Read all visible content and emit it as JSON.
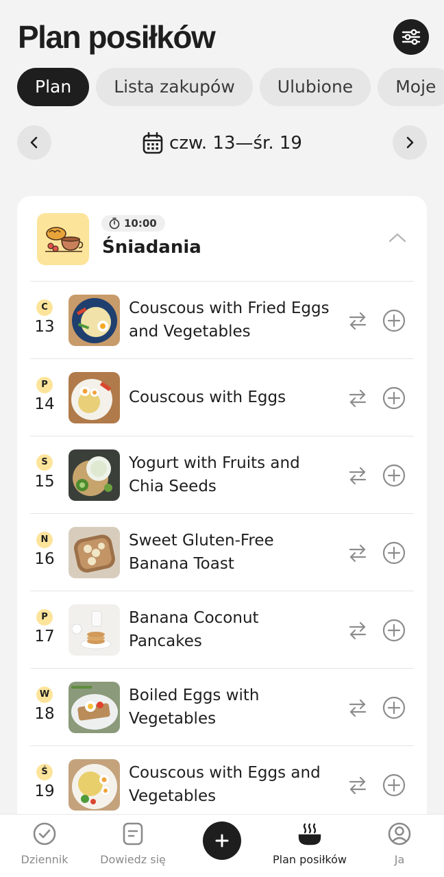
{
  "header": {
    "title": "Plan posiłków",
    "filter_icon": "sliders-icon"
  },
  "tabs": [
    {
      "label": "Plan",
      "active": true
    },
    {
      "label": "Lista zakupów",
      "active": false
    },
    {
      "label": "Ulubione",
      "active": false
    },
    {
      "label": "Moje",
      "active": false
    }
  ],
  "week": {
    "range": "czw. 13—śr. 19",
    "prev_icon": "chevron-left-icon",
    "next_icon": "chevron-right-icon",
    "calendar_icon": "calendar-icon"
  },
  "meal": {
    "time": "10:00",
    "name": "Śniadania",
    "icon": "breakfast-icon",
    "items": [
      {
        "day_letter": "C",
        "day_number": "13",
        "dish": "Couscous with Fried Eggs and Vegetables"
      },
      {
        "day_letter": "P",
        "day_number": "14",
        "dish": "Couscous with Eggs"
      },
      {
        "day_letter": "S",
        "day_number": "15",
        "dish": "Yogurt with Fruits and Chia Seeds"
      },
      {
        "day_letter": "N",
        "day_number": "16",
        "dish": "Sweet Gluten-Free Banana Toast"
      },
      {
        "day_letter": "P",
        "day_number": "17",
        "dish": "Banana Coconut Pancakes"
      },
      {
        "day_letter": "W",
        "day_number": "18",
        "dish": "Boiled Eggs with Vegetables"
      },
      {
        "day_letter": "Ś",
        "day_number": "19",
        "dish": "Couscous with Eggs and Vegetables"
      }
    ]
  },
  "bottom_nav": [
    {
      "label": "Dziennik",
      "icon": "check-circle-icon",
      "active": false
    },
    {
      "label": "Dowiedz się",
      "icon": "notes-icon",
      "active": false
    },
    {
      "label": "",
      "icon": "plus-icon",
      "active": false
    },
    {
      "label": "Plan posiłków",
      "icon": "cooking-pot-icon",
      "active": true
    },
    {
      "label": "Ja",
      "icon": "profile-icon",
      "active": false
    }
  ],
  "colors": {
    "accent": "#1e1e1e",
    "day_badge": "#fde49b",
    "background": "#f3f3f3"
  }
}
